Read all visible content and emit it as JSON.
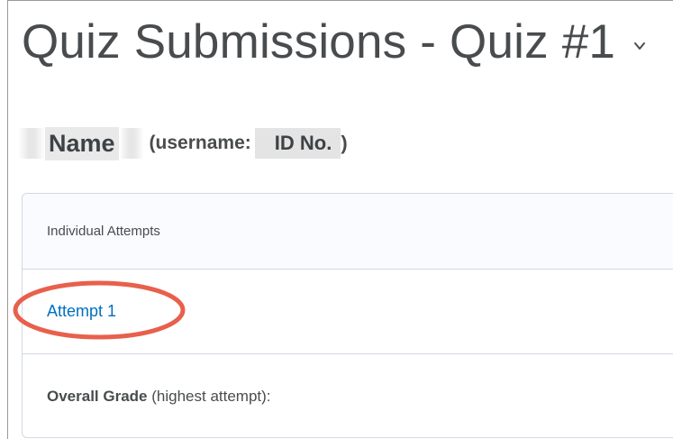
{
  "page": {
    "title": "Quiz Submissions - Quiz #1",
    "title_menu_icon": "chevron-down-icon"
  },
  "user": {
    "name": "Name",
    "username_prefix": "(username:",
    "id": "ID No.",
    "username_suffix": ")"
  },
  "attempts_panel": {
    "header": "Individual Attempts",
    "attempts": [
      {
        "label": "Attempt 1"
      }
    ],
    "overall_grade_label": "Overall Grade",
    "overall_grade_note": "(highest attempt):"
  },
  "annotation": {
    "type": "highlight-oval",
    "color": "#e8604c"
  },
  "colors": {
    "link": "#006fbf",
    "text": "#494c4e",
    "border": "#d3d9e3",
    "header_bg": "#f9fbff"
  }
}
